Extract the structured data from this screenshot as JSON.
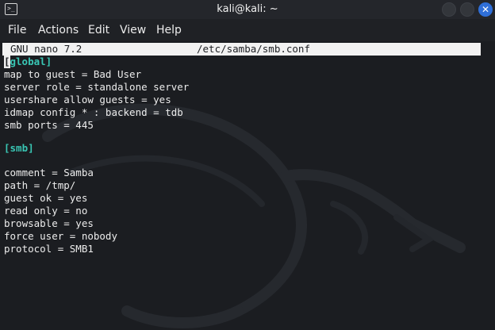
{
  "window": {
    "title": "kali@kali: ~",
    "terminal_icon_glyph": ">_"
  },
  "menu": {
    "items": [
      "File",
      "Actions",
      "Edit",
      "View",
      "Help"
    ]
  },
  "editor": {
    "name": "GNU nano 7.2",
    "file": "/etc/samba/smb.conf"
  },
  "config": {
    "global_header_bracket": "[",
    "global_header_rest": "global]",
    "global_lines": [
      "map to guest = Bad User",
      "server role = standalone server",
      "usershare allow guests = yes",
      "idmap config * : backend = tdb",
      "smb ports = 445"
    ],
    "smb_header": "[smb]",
    "smb_lines": [
      "comment = Samba",
      "path = /tmp/",
      "guest ok = yes",
      "read only = no",
      "browsable = yes",
      "force user = nobody",
      "protocol = SMB1"
    ]
  },
  "colors": {
    "background": "#1b1d21",
    "section_header": "#39c6b4",
    "close_button": "#2f6fd8"
  }
}
